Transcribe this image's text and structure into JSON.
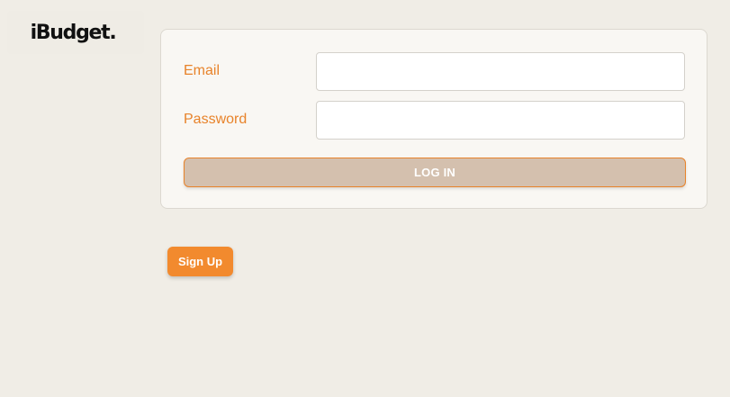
{
  "brand": {
    "logo_text": "iBudget."
  },
  "login_form": {
    "email_label": "Email",
    "email_value": "",
    "password_label": "Password",
    "password_value": "",
    "login_button_label": "LOG IN"
  },
  "signup": {
    "button_label": "Sign Up"
  },
  "colors": {
    "background": "#f0ede6",
    "accent": "#e8832a",
    "login_button_fill": "#d4c0ae",
    "signup_button_fill": "#f28a2e"
  }
}
